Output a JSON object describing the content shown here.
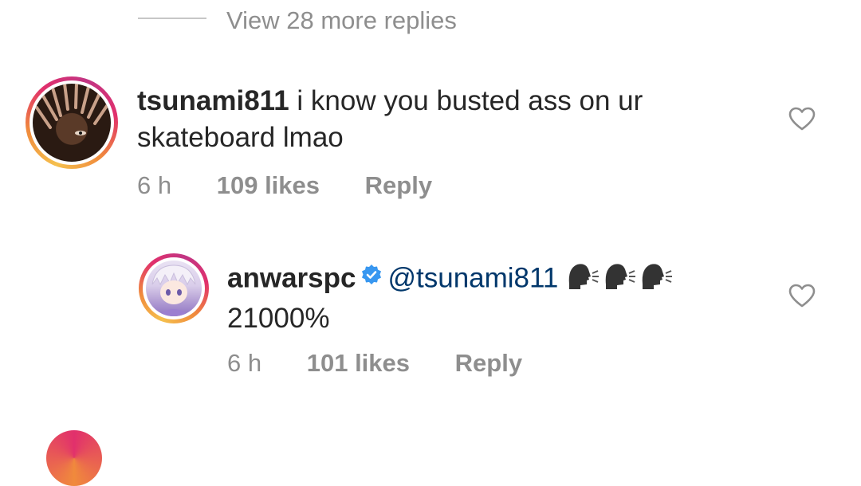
{
  "thread": {
    "view_more_replies": "View 28 more replies"
  },
  "comments": [
    {
      "username": "tsunami811",
      "text": "i know you busted ass on ur skateboard lmao",
      "time": "6 h",
      "likes": "109 likes",
      "reply": "Reply"
    },
    {
      "username": "anwarspc",
      "verified": true,
      "mention": "@tsunami811",
      "emoji": [
        "speaking-head-emoji",
        "speaking-head-emoji",
        "speaking-head-emoji"
      ],
      "text": "21000%",
      "time": "6 h",
      "likes": "101 likes",
      "reply": "Reply"
    }
  ],
  "colors": {
    "text": "#262626",
    "secondary": "#8e8e8e",
    "mention": "#00376b",
    "verified": "#3897f0"
  }
}
